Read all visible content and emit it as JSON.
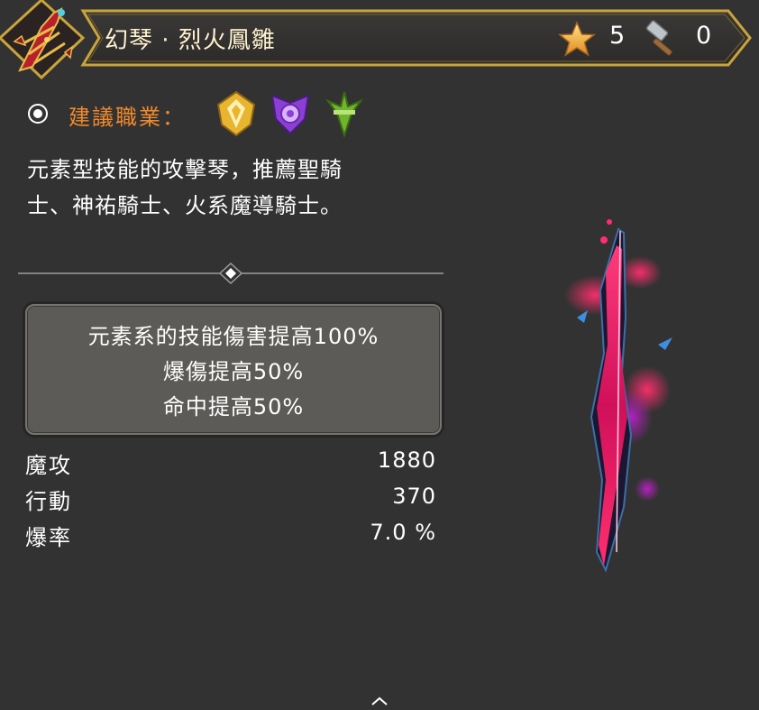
{
  "header": {
    "item_name": "幻琴 · 烈火鳳雛",
    "star_count": "5",
    "enhance_count": "0",
    "emblem_icon": "fire-harp-emblem-icon",
    "star_icon": "star-icon",
    "hammer_icon": "hammer-icon"
  },
  "recommend": {
    "label": "建議職業：",
    "classes": [
      {
        "icon": "paladin-class-icon",
        "color": "#e7b52f"
      },
      {
        "icon": "holy-knight-class-icon",
        "color": "#8b3fd6"
      },
      {
        "icon": "magic-knight-class-icon",
        "color": "#6fb52c"
      }
    ]
  },
  "description": {
    "line1": "元素型技能的攻擊琴，推薦聖騎",
    "line2": "士、神祐騎士、火系魔導騎士。"
  },
  "effects": [
    "元素系的技能傷害提高100%",
    "爆傷提高50%",
    "命中提高50%"
  ],
  "stats": [
    {
      "label": "魔攻",
      "value": "1880"
    },
    {
      "label": "行動",
      "value": "370"
    },
    {
      "label": "爆率",
      "value": "7.0 %"
    }
  ],
  "colors": {
    "background": "#333232",
    "gold_border": "#c9a43b",
    "accent_orange": "#f08a2c",
    "weapon_pink": "#ff2e6e"
  }
}
